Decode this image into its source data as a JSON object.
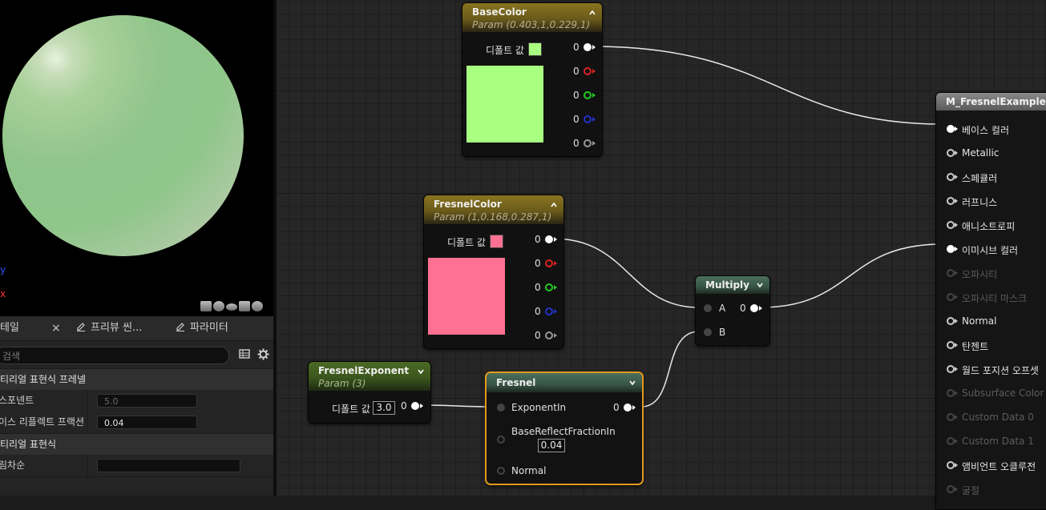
{
  "preview": {
    "axis_y": "y",
    "axis_x": "x",
    "view_buttons": [
      "cylinder-icon",
      "sphere-icon",
      "plane-icon",
      "cube-icon",
      "teapot-icon"
    ]
  },
  "tabs": [
    {
      "label": "테일",
      "close": "×"
    },
    {
      "label": "프리뷰 씬..."
    },
    {
      "label": "파라미터"
    }
  ],
  "search": {
    "placeholder": "검색"
  },
  "details": {
    "section1": "티리얼 표현식 프레넬",
    "rows1": [
      {
        "label": "스포넨트",
        "value": "5.0"
      },
      {
        "label": "이스 리플렉트 프랙션",
        "value": "0.04"
      }
    ],
    "section2": "티리얼 표현식",
    "rows2": [
      {
        "label": "림차순",
        "value": ""
      }
    ]
  },
  "nodes": {
    "basecolor": {
      "title": "BaseColor",
      "subtitle": "Param (0.403,1,0.229,1)",
      "default_label": "디폴트 값",
      "swatch_color": "#a9ff80",
      "outputs": [
        "0",
        "0",
        "0",
        "0",
        "0"
      ]
    },
    "fresnelcolor": {
      "title": "FresnelColor",
      "subtitle": "Param (1,0.168,0.287,1)",
      "default_label": "디폴트 값",
      "swatch_color": "#ff7192",
      "outputs": [
        "0",
        "0",
        "0",
        "0",
        "0"
      ]
    },
    "fresnelexponent": {
      "title": "FresnelExponent",
      "subtitle": "Param (3)",
      "default_label": "디폴트 값",
      "value": "3.0",
      "output": "0"
    },
    "fresnel": {
      "title": "Fresnel",
      "inputs": [
        "ExponentIn",
        "BaseReflectFractionIn",
        "Normal"
      ],
      "brf_value": "0.04",
      "output": "0"
    },
    "multiply": {
      "title": "Multiply",
      "inputs": [
        "A",
        "B"
      ],
      "output": "0"
    },
    "material": {
      "title": "M_FresnelExample",
      "inputs": [
        {
          "label": "베이스 컬러",
          "state": "connected"
        },
        {
          "label": "Metallic",
          "state": "active"
        },
        {
          "label": "스페큘러",
          "state": "active"
        },
        {
          "label": "러프니스",
          "state": "active"
        },
        {
          "label": "애니소트로피",
          "state": "active"
        },
        {
          "label": "이미시브 컬러",
          "state": "connected"
        },
        {
          "label": "오파시티",
          "state": "disabled"
        },
        {
          "label": "오파시티 마스크",
          "state": "disabled"
        },
        {
          "label": "Normal",
          "state": "active"
        },
        {
          "label": "탄젠트",
          "state": "active"
        },
        {
          "label": "월드 포지션 오프셋",
          "state": "active"
        },
        {
          "label": "Subsurface Color",
          "state": "disabled"
        },
        {
          "label": "Custom Data 0",
          "state": "disabled"
        },
        {
          "label": "Custom Data 1",
          "state": "disabled"
        },
        {
          "label": "앰비언트 오클루전",
          "state": "active"
        },
        {
          "label": "굴절",
          "state": "disabled"
        }
      ]
    }
  },
  "colors": {
    "selection": "#e39a1c",
    "param_header": "#8a7420",
    "wire": "#e8e8e8"
  }
}
